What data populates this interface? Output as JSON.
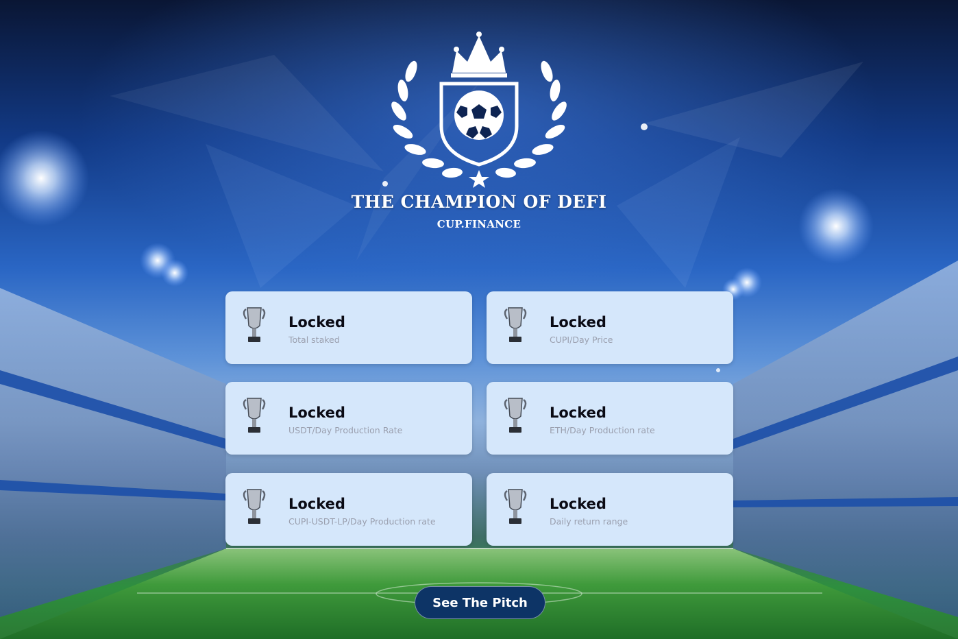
{
  "logo": {
    "title": "THE CHAMPION OF DEFI",
    "subtitle": "CUP.FINANCE",
    "icon": "crown-shield-soccer-ball-laurel-icon"
  },
  "stats": [
    {
      "value": "Locked",
      "label": "Total staked",
      "icon": "trophy-icon"
    },
    {
      "value": "Locked",
      "label": "CUPI/Day Price",
      "icon": "trophy-icon"
    },
    {
      "value": "Locked",
      "label": "USDT/Day Production Rate",
      "icon": "trophy-icon"
    },
    {
      "value": "Locked",
      "label": "ETH/Day Production rate",
      "icon": "trophy-icon"
    },
    {
      "value": "Locked",
      "label": "CUPI-USDT-LP/Day Production rate",
      "icon": "trophy-icon"
    },
    {
      "value": "Locked",
      "label": "Daily return range",
      "icon": "trophy-icon"
    }
  ],
  "cta": {
    "label": "See The Pitch"
  },
  "colors": {
    "card_bg": "#d5e7fb",
    "button_bg": "#0d3466",
    "label_text": "#9a9fae",
    "value_text": "#0a0a14"
  }
}
